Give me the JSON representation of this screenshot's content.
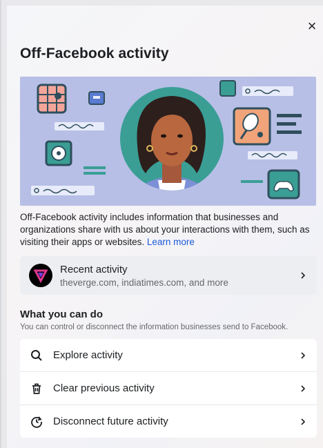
{
  "dialog": {
    "close_label": "×",
    "title": "Off-Facebook activity",
    "description": "Off-Facebook activity includes information that businesses and organizations share with us about your interactions with them, such as visiting their apps or websites.",
    "learn_more": "Learn more"
  },
  "recent": {
    "title": "Recent activity",
    "subtitle": "theverge.com, indiatimes.com, and more",
    "avatar_icon": "the-verge-logo"
  },
  "section": {
    "title": "What you can do",
    "subtitle": "You can control or disconnect the information businesses send to Facebook."
  },
  "actions": [
    {
      "label": "Explore activity",
      "icon": "search-icon"
    },
    {
      "label": "Clear previous activity",
      "icon": "trash-icon"
    },
    {
      "label": "Disconnect future activity",
      "icon": "history-icon"
    }
  ],
  "colors": {
    "accent": "#1a5ad8",
    "hero_bg": "#b7bfe6",
    "text": "#1c1e21",
    "muted": "#65676b"
  }
}
